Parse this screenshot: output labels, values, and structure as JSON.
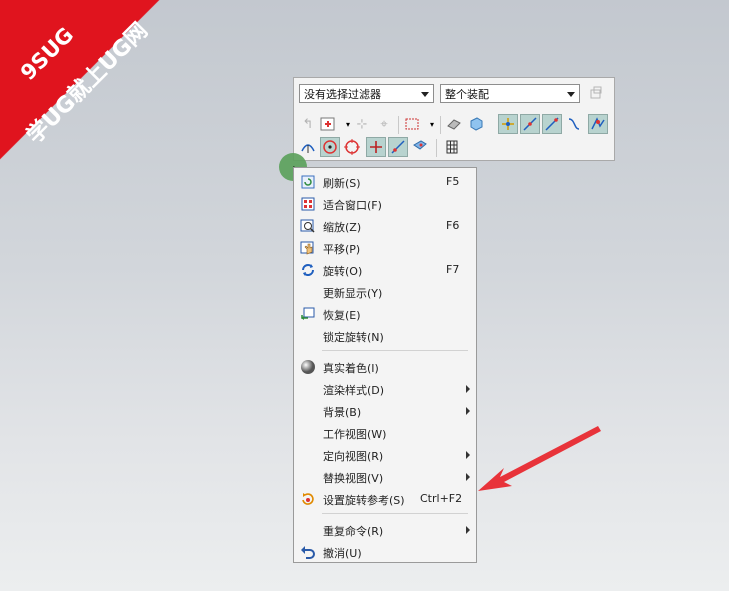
{
  "watermark": {
    "line1": "9SUG",
    "line2": "学UG就上UG网"
  },
  "toolbar": {
    "filter_combo": "没有选择过滤器",
    "scope_combo": "整个装配"
  },
  "menu": {
    "items": [
      {
        "label": "刷新(S)",
        "shortcut": "F5",
        "icon": "refresh-icon"
      },
      {
        "label": "适合窗口(F)",
        "shortcut": "",
        "icon": "fit-window-icon"
      },
      {
        "label": "缩放(Z)",
        "shortcut": "F6",
        "icon": "zoom-icon"
      },
      {
        "label": "平移(P)",
        "shortcut": "",
        "icon": "pan-icon"
      },
      {
        "label": "旋转(O)",
        "shortcut": "F7",
        "icon": "rotate-icon"
      },
      {
        "label": "更新显示(Y)",
        "shortcut": "",
        "icon": ""
      },
      {
        "label": "恢复(E)",
        "shortcut": "",
        "icon": "restore-icon"
      },
      {
        "label": "锁定旋转(N)",
        "shortcut": "",
        "icon": ""
      },
      {
        "label": "真实着色(I)",
        "shortcut": "",
        "icon": "true-shading-icon"
      },
      {
        "label": "渲染样式(D)",
        "shortcut": "",
        "icon": "",
        "submenu": true
      },
      {
        "label": "背景(B)",
        "shortcut": "",
        "icon": "",
        "submenu": true
      },
      {
        "label": "工作视图(W)",
        "shortcut": "",
        "icon": ""
      },
      {
        "label": "定向视图(R)",
        "shortcut": "",
        "icon": "",
        "submenu": true
      },
      {
        "label": "替换视图(V)",
        "shortcut": "",
        "icon": "",
        "submenu": true
      },
      {
        "label": "设置旋转参考(S)",
        "shortcut": "Ctrl+F2",
        "icon": "set-rotate-ref-icon"
      },
      {
        "label": "重复命令(R)",
        "shortcut": "",
        "icon": "",
        "submenu": true
      },
      {
        "label": "撤消(U)",
        "shortcut": "",
        "icon": "undo-icon"
      }
    ]
  }
}
